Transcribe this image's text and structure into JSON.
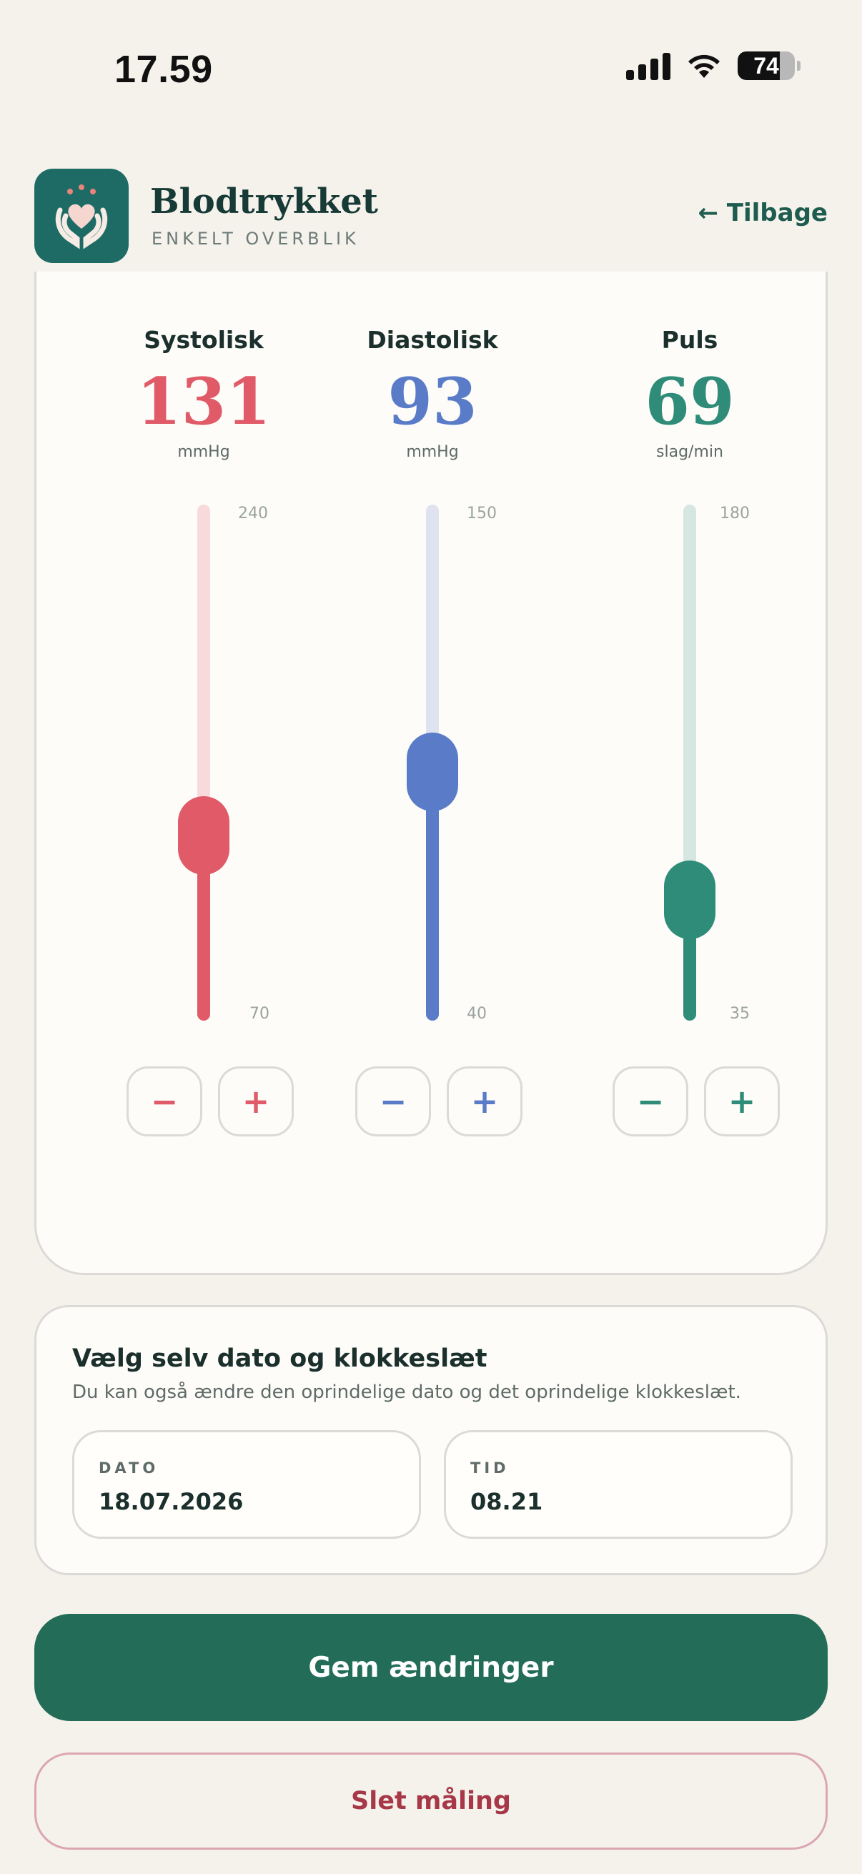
{
  "status_bar": {
    "time": "17.59",
    "battery": "74",
    "battery_level": 0.74
  },
  "header": {
    "app_name": "Blodtrykket",
    "subtitle": "ENKELT OVERBLIK",
    "back_label": "← Tilbage"
  },
  "metrics": [
    {
      "label": "Systolisk",
      "value": "131",
      "unit": "mmHg",
      "max": "240",
      "min": "70",
      "level": 0.359,
      "color": "#e05a68",
      "track_color": "#f8dadd"
    },
    {
      "label": "Diastolisk",
      "value": "93",
      "unit": "mmHg",
      "max": "150",
      "min": "40",
      "level": 0.482,
      "color": "#5a7cc8",
      "track_color": "#dfe3f0"
    },
    {
      "label": "Puls",
      "value": "69",
      "unit": "slag/min",
      "max": "180",
      "min": "35",
      "level": 0.234,
      "color": "#2e8c78",
      "track_color": "#d6e7e2"
    }
  ],
  "controls": {
    "minus": "−",
    "plus": "+"
  },
  "date_section": {
    "title": "Vælg selv dato og klokkeslæt",
    "subtitle": "Du kan også ændre den oprindelige dato og det oprindelige klokkeslæt.",
    "date_label": "DATO",
    "date_value": "18.07.2026",
    "time_label": "TID",
    "time_value": "08.21"
  },
  "actions": {
    "save": "Gem ændringer",
    "delete": "Slet måling"
  }
}
